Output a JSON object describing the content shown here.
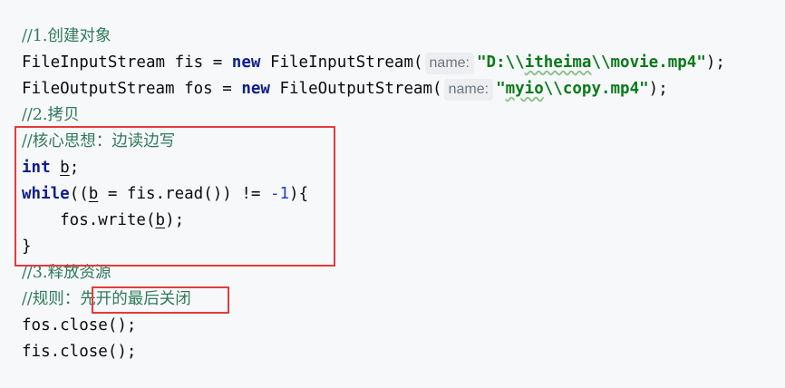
{
  "code": {
    "line1": "//1.创建对象",
    "line2": {
      "t1": "FileInputStream fis = ",
      "kw": "new",
      "t2": " FileInputStream(",
      "hint": "name:",
      "q1": "\"D:\\\\",
      "w": "itheima",
      "q2": "\\\\movie.mp4\"",
      "end": ");"
    },
    "line3": {
      "t1": "FileOutputStream fos = ",
      "kw": "new",
      "t2": " FileOutputStream(",
      "hint": "name:",
      "q1": "\"",
      "w": "myio",
      "q2": "\\\\copy.mp4\"",
      "end": ");"
    },
    "line4": "//2.拷贝",
    "line5": "//核心思想：边读边写",
    "line6": {
      "kw": "int",
      "sp": " ",
      "v": "b",
      "end": ";"
    },
    "line7": {
      "kw": "while",
      "p1": "((",
      "v": "b",
      "t1": " = fis.read()) != ",
      "num": "-1",
      "end": "){"
    },
    "line8": {
      "t1": "    fos.write(",
      "v": "b",
      "end": ");"
    },
    "line9": "}",
    "line10": "//3.释放资源",
    "line11": {
      "c1": "//规则：",
      "c2": "先开的最后关闭"
    },
    "line12": "fos.close();",
    "line13": "fis.close();"
  },
  "colors": {
    "comment": "#2f7a5a",
    "keyword": "#0d1f8c",
    "string": "#0a7a1a",
    "highlight_box": "#e23b3b"
  }
}
